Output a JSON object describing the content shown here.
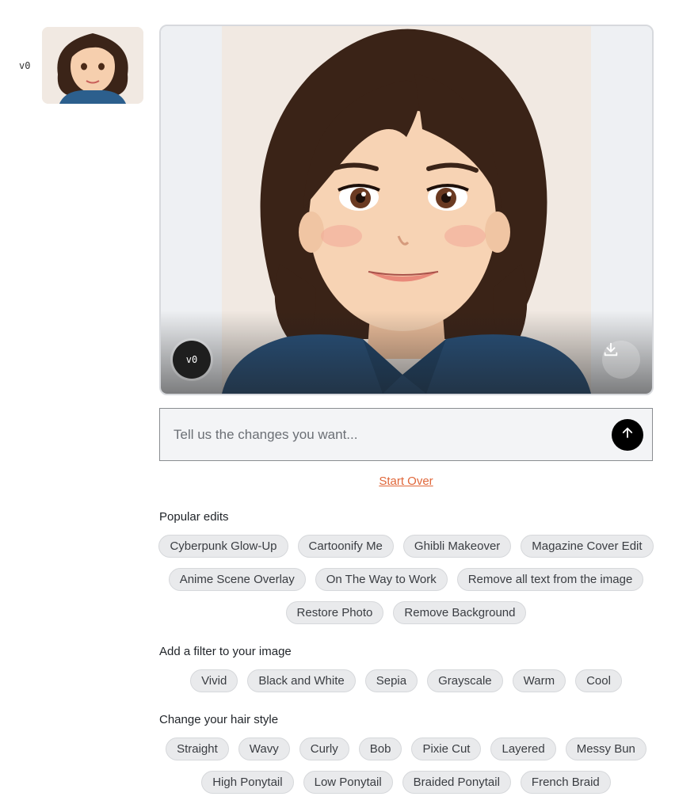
{
  "history": {
    "version_label": "v0"
  },
  "preview": {
    "version_badge": "v0",
    "download_icon": "download-icon"
  },
  "prompt": {
    "placeholder": "Tell us the changes you want...",
    "value": "",
    "send_icon": "arrow-up-icon"
  },
  "start_over_label": "Start Over",
  "sections": [
    {
      "title": "Popular edits",
      "rows": [
        [
          "Cyberpunk Glow-Up",
          "Cartoonify Me",
          "Ghibli Makeover",
          "Magazine Cover Edit"
        ],
        [
          "Anime Scene Overlay",
          "On The Way to Work",
          "Remove all text from the image"
        ],
        [
          "Restore Photo",
          "Remove Background"
        ]
      ]
    },
    {
      "title": "Add a filter to your image",
      "rows": [
        [
          "Vivid",
          "Black and White",
          "Sepia",
          "Grayscale",
          "Warm",
          "Cool"
        ]
      ]
    },
    {
      "title": "Change your hair style",
      "rows": [
        [
          "Straight",
          "Wavy",
          "Curly",
          "Bob",
          "Pixie Cut",
          "Layered",
          "Messy Bun"
        ],
        [
          "High Ponytail",
          "Low Ponytail",
          "Braided Ponytail",
          "French Braid"
        ]
      ]
    }
  ],
  "colors": {
    "accent_link": "#e0673a",
    "chip_bg": "#e9eaec",
    "send_button": "#000000"
  }
}
